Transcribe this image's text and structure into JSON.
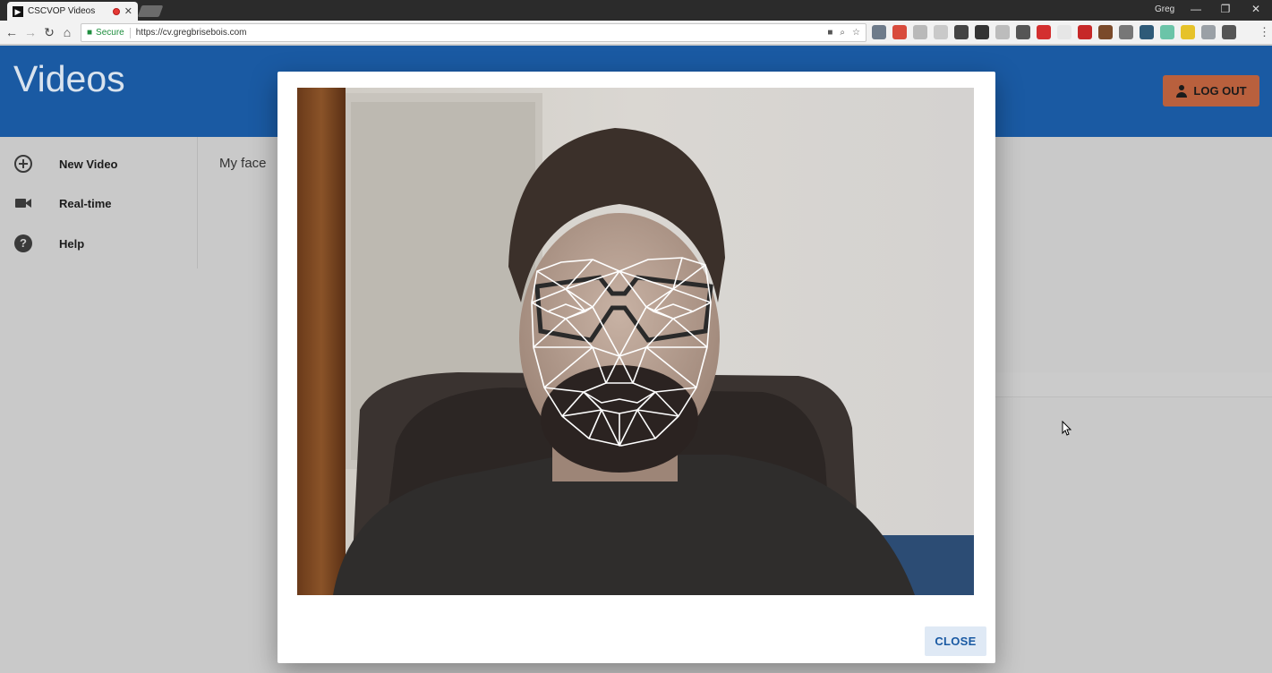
{
  "browser": {
    "tab_title": "CSCVOP Videos",
    "tab_favicon": "▶",
    "user_name": "Greg",
    "secure_label": "Secure",
    "url": "https://cv.gregbrisebois.com",
    "icons": {
      "back": "←",
      "forward": "→",
      "reload": "↻",
      "home": "⌂",
      "lock": "■",
      "camera": "■",
      "zoom": "⌕",
      "bookmark": "☆",
      "menu": "⋮",
      "minimize": "—",
      "restore": "❐",
      "close": "✕",
      "tab_close": "✕"
    },
    "extension_colors": [
      "#6e7b8a",
      "#d84b3c",
      "#b9b9b9",
      "#c9c9c9",
      "#444444",
      "#333333",
      "#bcbcbc",
      "#555555",
      "#d32f2f",
      "#e6e6e6",
      "#c62828",
      "#7a4a2a",
      "#777777",
      "#2e5a78",
      "#6bc4a8",
      "#e6c229",
      "#9aa0a6",
      "#555555"
    ]
  },
  "app": {
    "title": "Videos",
    "logout_label": "LOG OUT",
    "sidebar": [
      {
        "label": "New Video",
        "icon": "plus-circle-icon"
      },
      {
        "label": "Real-time",
        "icon": "camera-icon"
      },
      {
        "label": "Help",
        "icon": "help-icon"
      }
    ],
    "help_glyph": "?",
    "video_title": "My face"
  },
  "dialog": {
    "close_label": "CLOSE",
    "video_description": "webcam frame with face-mesh overlay"
  },
  "colors": {
    "header": "#1a5aa3",
    "logout": "#b9603d",
    "close_text": "#1a5aa3"
  }
}
